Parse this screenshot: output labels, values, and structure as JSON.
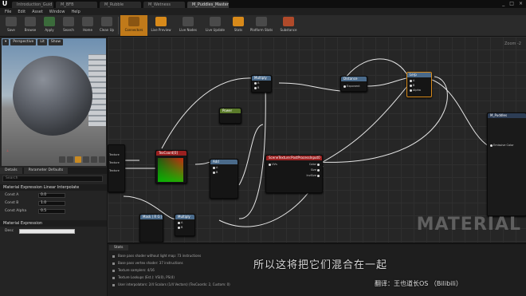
{
  "app": {
    "logo": "U"
  },
  "tabs": [
    {
      "label": "Introduction_Guid"
    },
    {
      "label": "M_BFB"
    },
    {
      "label": "M_Rubble"
    },
    {
      "label": "M_Wetness"
    },
    {
      "label": "M_Puddles_Master"
    }
  ],
  "window_controls": [
    "_",
    "□",
    "×"
  ],
  "menu": [
    "File",
    "Edit",
    "Asset",
    "Window",
    "Help"
  ],
  "toolbar": [
    {
      "label": "Save",
      "icon": "save-icon"
    },
    {
      "label": "Browse",
      "icon": "browse-icon"
    },
    {
      "label": "Apply",
      "icon": "apply-icon"
    },
    {
      "label": "Search",
      "icon": "search-icon"
    },
    {
      "label": "Home",
      "icon": "home-icon"
    },
    {
      "label": "Clean Up",
      "icon": "cleanup-icon"
    },
    {
      "label": "Connectors",
      "icon": "connectors-icon"
    },
    {
      "label": "Live Preview",
      "icon": "live-preview-icon"
    },
    {
      "label": "Live Nodes",
      "icon": "live-nodes-icon"
    },
    {
      "label": "Live Update",
      "icon": "live-update-icon"
    },
    {
      "label": "Stats",
      "icon": "stats-icon"
    },
    {
      "label": "Platform Stats",
      "icon": "platform-stats-icon"
    },
    {
      "label": "Substance",
      "icon": "substance-icon"
    }
  ],
  "viewport": {
    "buttons": [
      "▾",
      "Perspective",
      "Lit",
      "Show"
    ]
  },
  "panel_tabs": [
    "Details",
    "Parameter Defaults"
  ],
  "search": {
    "placeholder": "Search"
  },
  "details": {
    "section1": "Material Expression Linear Interpolate",
    "rows": [
      {
        "label": "Const A",
        "value": "0.0"
      },
      {
        "label": "Const B",
        "value": "1.0"
      },
      {
        "label": "Const Alpha",
        "value": "0.5"
      }
    ],
    "section2": "Material Expression",
    "desc_label": "Desc"
  },
  "graph": {
    "zoom": "Zoom -2",
    "watermark": "MATERIAL",
    "nodes": {
      "multiply_top": {
        "title": "Multiply",
        "pins": [
          "A",
          "B"
        ]
      },
      "power_green": {
        "title": "Power"
      },
      "lerp_top": {
        "title": "Lerp",
        "pins": [
          "A",
          "B",
          "Alpha"
        ]
      },
      "distance": {
        "title": "Distance",
        "pins": [
          "Exponent"
        ]
      },
      "result": {
        "title": "M_Puddles",
        "pins": [
          "Emissive Color"
        ]
      },
      "texcoord": {
        "title": "TexCoord[0]",
        "pins": [
          "Texture",
          "Texture",
          "Texture"
        ]
      },
      "add": {
        "title": "Add",
        "pins": [
          "A",
          "B"
        ]
      },
      "scene": {
        "title": "SceneTexture:PostProcessInput0",
        "pins": [
          "UVs",
          "Color",
          "Size",
          "InvSize"
        ]
      },
      "mask": {
        "title": "Mask ( R G )"
      },
      "multiply_bot": {
        "title": "Multiply",
        "pins": [
          "A",
          "B"
        ]
      }
    }
  },
  "log": {
    "tab": "Stats",
    "lines": [
      "Base pass shader without light map: 73 instructions",
      "Base pass vertex shader: 37 instructions",
      "Texture samplers: 4/16",
      "Texture Lookups (Est.): VS(0), PS(4)",
      "User interpolators: 2/4 Scalars (1/4 Vectors) (TexCoords: 2, Custom: 0)"
    ]
  },
  "subtitles": {
    "line1": "所以这将把它们混合在一起",
    "credit": "翻译：王也道长OS （Bilibili）"
  },
  "colors": {
    "accent": "#d88a1a",
    "node_orange": "#c27a1e",
    "node_green": "#5a7a2a",
    "node_red": "#9a2020",
    "node_blue": "#4a6a8a"
  }
}
